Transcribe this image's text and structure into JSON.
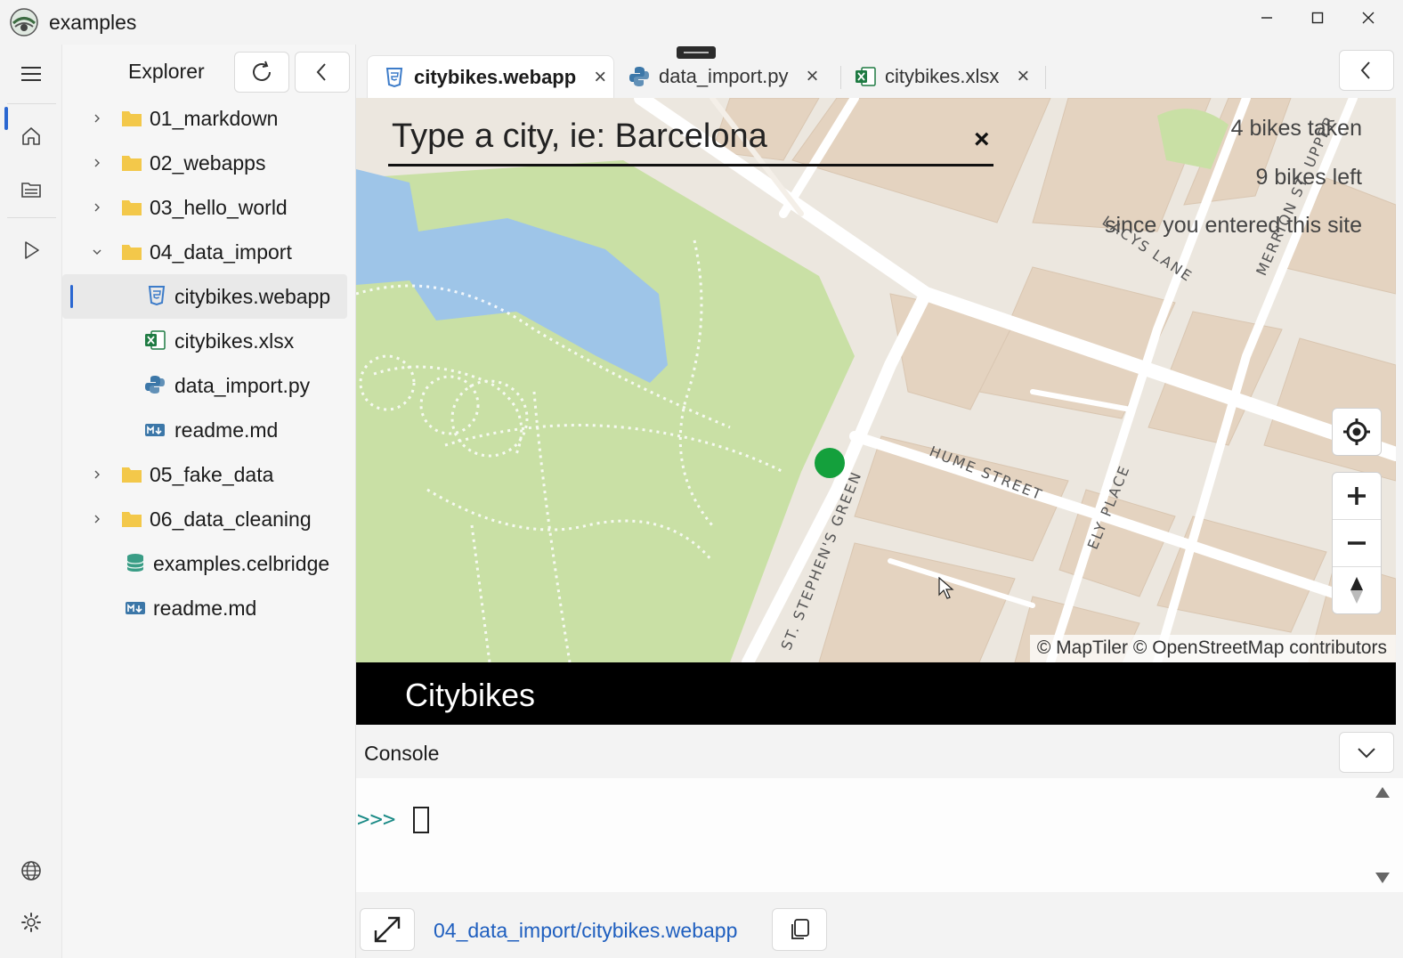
{
  "window": {
    "title": "examples",
    "controls": [
      "minimize",
      "maximize",
      "close"
    ]
  },
  "activity_bar": {
    "items": [
      {
        "name": "menu-icon"
      },
      {
        "name": "home-icon"
      },
      {
        "name": "files-icon"
      },
      {
        "name": "run-icon"
      },
      {
        "name": "globe-icon"
      },
      {
        "name": "settings-icon"
      }
    ]
  },
  "explorer": {
    "title": "Explorer",
    "tree": [
      {
        "label": "01_markdown",
        "type": "folder",
        "expanded": false,
        "depth": 0
      },
      {
        "label": "02_webapps",
        "type": "folder",
        "expanded": false,
        "depth": 0
      },
      {
        "label": "03_hello_world",
        "type": "folder",
        "expanded": false,
        "depth": 0
      },
      {
        "label": "04_data_import",
        "type": "folder",
        "expanded": true,
        "depth": 0
      },
      {
        "label": "citybikes.webapp",
        "type": "webapp",
        "depth": 1,
        "selected": true
      },
      {
        "label": "citybikes.xlsx",
        "type": "excel",
        "depth": 1
      },
      {
        "label": "data_import.py",
        "type": "python",
        "depth": 1
      },
      {
        "label": "readme.md",
        "type": "markdown",
        "depth": 1
      },
      {
        "label": "05_fake_data",
        "type": "folder",
        "expanded": false,
        "depth": 0
      },
      {
        "label": "06_data_cleaning",
        "type": "folder",
        "expanded": false,
        "depth": 0
      },
      {
        "label": "examples.celbridge",
        "type": "database",
        "depth": 0
      },
      {
        "label": "readme.md",
        "type": "markdown",
        "depth": 0
      }
    ]
  },
  "tabs": [
    {
      "label": "citybikes.webapp",
      "icon": "webapp-icon",
      "active": true
    },
    {
      "label": "data_import.py",
      "icon": "python-icon",
      "active": false
    },
    {
      "label": "citybikes.xlsx",
      "icon": "excel-icon",
      "active": false
    }
  ],
  "webapp": {
    "search_placeholder": "Type a city, ie: Barcelona",
    "clear_symbol": "×",
    "bikes_taken": "4 bikes taken",
    "bikes_left": "9 bikes left",
    "since_text": "since you entered this site",
    "streets": {
      "hume": "HUME STREET",
      "stephens": "ST. STEPHEN'S GREEN",
      "ely": "ELY PLACE",
      "lacys": "LACYS LANE",
      "merrion": "MERRION ST. UPPER"
    },
    "attribution": "© MapTiler © OpenStreetMap contributors",
    "footer_title": "Citybikes",
    "colors": {
      "park": "#c7dfa3",
      "water": "#9ec5e8",
      "buildings": "#e5d4c1",
      "marker": "#14a03c"
    }
  },
  "console": {
    "title": "Console",
    "prompt": ">>>"
  },
  "status": {
    "path": "04_data_import/citybikes.webapp"
  }
}
